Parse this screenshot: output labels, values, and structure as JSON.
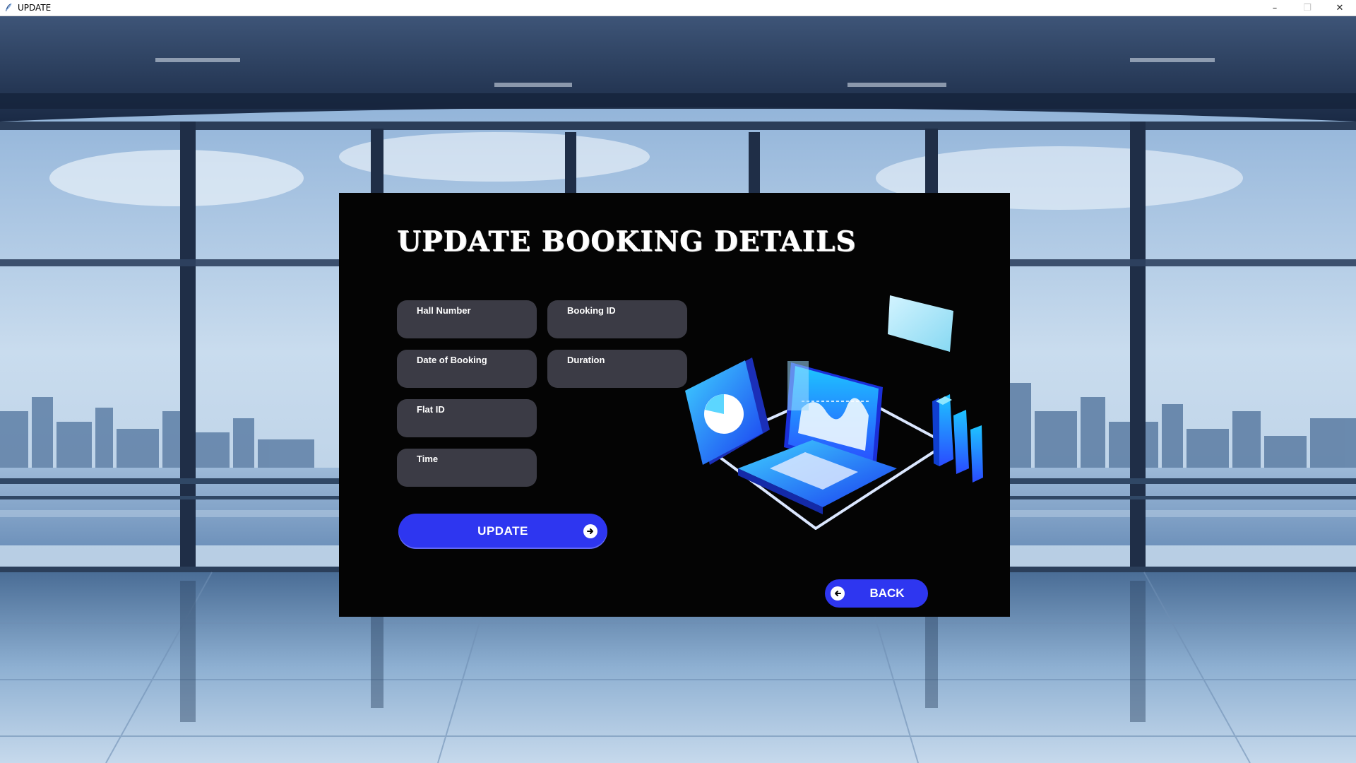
{
  "window": {
    "title": "UPDATE",
    "controls": {
      "minimize": "–",
      "maximize": "❐",
      "close": "✕"
    }
  },
  "form": {
    "heading": "UPDATE BOOKING DETAILS",
    "fields": {
      "hall_number": {
        "label": "Hall Number",
        "value": ""
      },
      "booking_id": {
        "label": "Booking ID",
        "value": ""
      },
      "date_of_booking": {
        "label": "Date of Booking",
        "value": ""
      },
      "duration": {
        "label": "Duration",
        "value": ""
      },
      "flat_id": {
        "label": "Flat ID",
        "value": ""
      },
      "time": {
        "label": "Time",
        "value": ""
      }
    },
    "update_button": {
      "label": "UPDATE",
      "icon": "arrow-right-circle-icon"
    },
    "back_button": {
      "label": "BACK",
      "icon": "arrow-left-circle-icon"
    }
  },
  "colors": {
    "panel_bg": "#040404",
    "field_bg": "#3b3b45",
    "button_bg": "#2e36f0",
    "title_bar_bg": "#ffffff"
  },
  "background": {
    "scene": "office-window-cityscape"
  }
}
